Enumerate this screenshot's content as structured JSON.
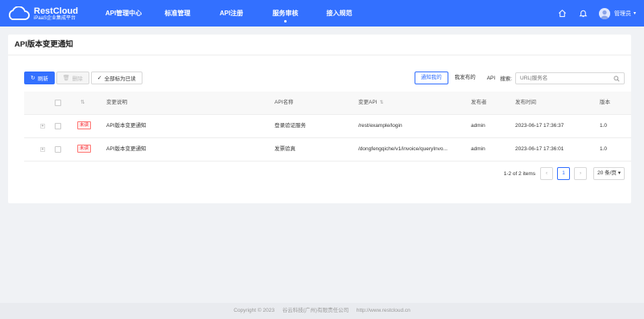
{
  "brand": {
    "name": "RestCloud",
    "tagline": "iPaaS企业集成平台"
  },
  "nav": [
    {
      "label": "API管理中心"
    },
    {
      "label": "标准管理"
    },
    {
      "label": "API注册"
    },
    {
      "label": "服务审核"
    },
    {
      "label": "接入规范"
    }
  ],
  "user": {
    "name": "管理员"
  },
  "page": {
    "title": "API版本变更通知"
  },
  "toolbar": {
    "refresh": "刷新",
    "delete": "删除",
    "mark_all_read": "全部标为已读"
  },
  "filters": {
    "notify_me": "通知我的",
    "my_published": "我发布的",
    "api_label": "API",
    "search_label": "搜索:",
    "search_placeholder": "URL|服务名"
  },
  "table": {
    "columns": [
      "变更说明",
      "API名称",
      "变更API",
      "发布者",
      "发布时间",
      "版本"
    ],
    "rows": [
      {
        "expand": "+",
        "status": "未读",
        "description": "API版本变更通知",
        "api_name": "登录验证服务",
        "api_path": "/rest/example/login",
        "publisher": "admin",
        "time": "2023-06-17 17:36:37",
        "version": "1.0"
      },
      {
        "expand": "+",
        "status": "未读",
        "description": "API版本变更通知",
        "api_name": "发票验真",
        "api_path": "/dongfengqiche/v1/invoice/queryInvo...",
        "publisher": "admin",
        "time": "2023-06-17 17:36:01",
        "version": "1.0"
      }
    ]
  },
  "pagination": {
    "summary": "1-2 of 2 items",
    "current": "1",
    "page_size": "20 条/页"
  },
  "footer": {
    "copyright": "Copyright © 2023",
    "company": "谷云科技(广州)有限责任公司",
    "url": "http://www.restcloud.cn"
  },
  "colors": {
    "primary": "#3370ff",
    "unread": "#f5222d"
  },
  "icons": [
    "cloud-logo-icon",
    "home-icon",
    "bell-icon",
    "refresh-icon",
    "trash-icon",
    "check-icon",
    "search-icon",
    "sort-icon",
    "chevron-left-icon",
    "chevron-right-icon",
    "chevron-down-icon"
  ]
}
